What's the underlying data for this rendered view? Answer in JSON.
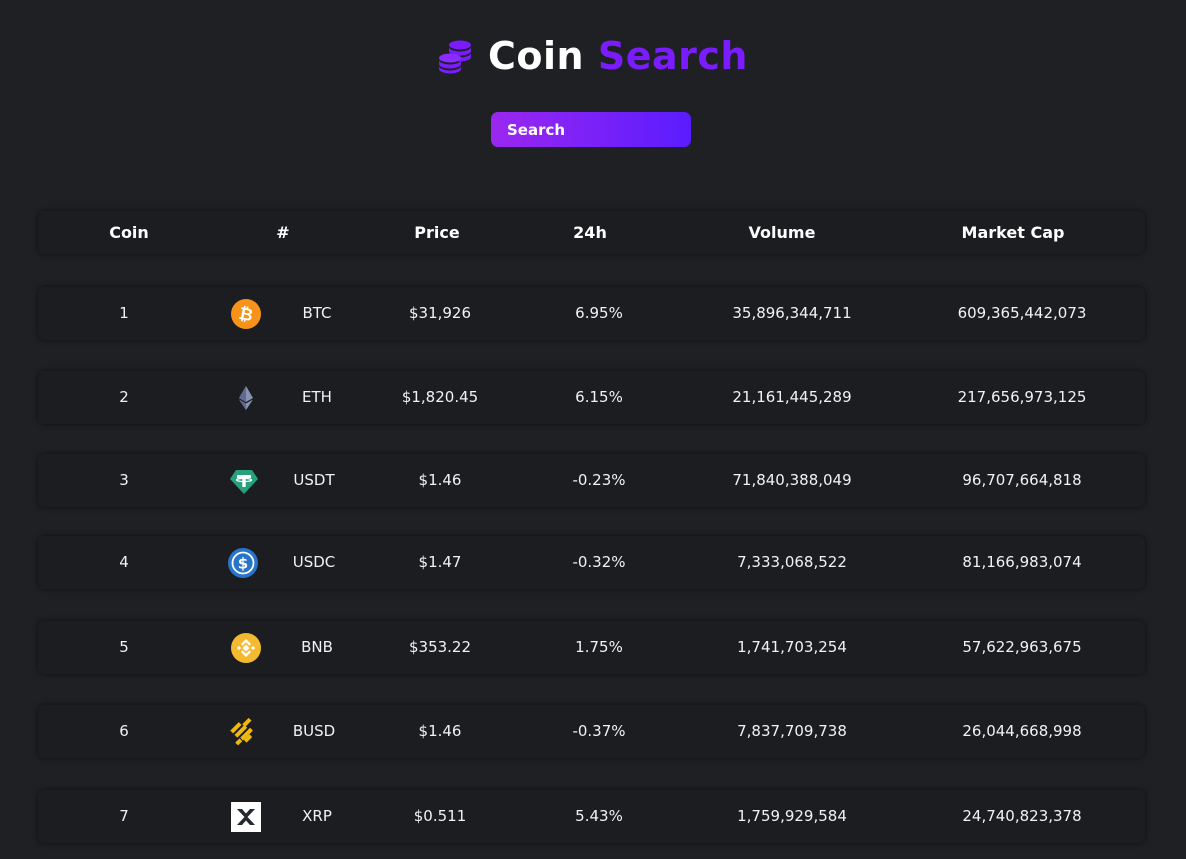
{
  "app": {
    "title_word1": "Coin",
    "title_word2": "Search",
    "logo_icon": "coins-stack-icon"
  },
  "search": {
    "placeholder": "Search",
    "value": ""
  },
  "table": {
    "headers": [
      "Coin",
      "#",
      "Price",
      "24h",
      "Volume",
      "Market Cap"
    ],
    "rows": [
      {
        "rank": "1",
        "icon": "bitcoin-icon",
        "symbol": "BTC",
        "price": "$31,926",
        "change_24h": "6.95%",
        "volume": "35,896,344,711",
        "market_cap": "609,365,442,073"
      },
      {
        "rank": "2",
        "icon": "ethereum-icon",
        "symbol": "ETH",
        "price": "$1,820.45",
        "change_24h": "6.15%",
        "volume": "21,161,445,289",
        "market_cap": "217,656,973,125"
      },
      {
        "rank": "3",
        "icon": "tether-icon",
        "symbol": "USDT",
        "price": "$1.46",
        "change_24h": "-0.23%",
        "volume": "71,840,388,049",
        "market_cap": "96,707,664,818"
      },
      {
        "rank": "4",
        "icon": "usd-coin-icon",
        "symbol": "USDC",
        "price": "$1.47",
        "change_24h": "-0.32%",
        "volume": "7,333,068,522",
        "market_cap": "81,166,983,074"
      },
      {
        "rank": "5",
        "icon": "bnb-icon",
        "symbol": "BNB",
        "price": "$353.22",
        "change_24h": "1.75%",
        "volume": "1,741,703,254",
        "market_cap": "57,622,963,675"
      },
      {
        "rank": "6",
        "icon": "busd-icon",
        "symbol": "BUSD",
        "price": "$1.46",
        "change_24h": "-0.37%",
        "volume": "7,837,709,738",
        "market_cap": "26,044,668,998"
      },
      {
        "rank": "7",
        "icon": "xrp-icon",
        "symbol": "XRP",
        "price": "$0.511",
        "change_24h": "5.43%",
        "volume": "1,759,929,584",
        "market_cap": "24,740,823,378"
      }
    ]
  },
  "colors": {
    "background": "#1f2024",
    "row_background": "#1c1d20",
    "accent_purple": "#7b1cff",
    "search_gradient_start": "#9b27f0",
    "search_gradient_end": "#5a1cff"
  }
}
